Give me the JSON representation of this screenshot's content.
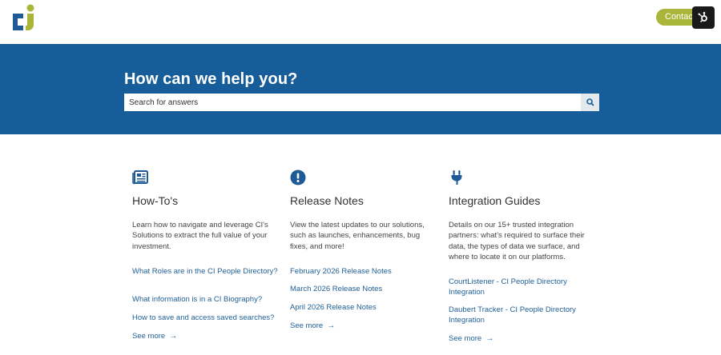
{
  "header": {
    "logo_icon": "ci-logo-icon",
    "contact_label": "Contact",
    "hub_icon": "hubspot-icon"
  },
  "hero": {
    "title": "How can we help you?",
    "search_placeholder": "Search for answers",
    "search_icon": "search-icon"
  },
  "columns": [
    {
      "icon": "newspaper-icon",
      "title": "How-To's",
      "description": "Learn how to navigate and leverage CI's Solutions to extract the full value of your investment.",
      "links": [
        "What Roles are in the CI People Directory?",
        "What information is in a CI Biography?",
        "How to save and access saved searches?"
      ],
      "see_more": "See more"
    },
    {
      "icon": "exclamation-circle-icon",
      "title": "Release Notes",
      "description": "View the latest updates to our solutions, such as launches, enhancements, bug fixes, and more!",
      "links": [
        "February 2026 Release Notes",
        "March 2026 Release Notes",
        "April 2026 Release Notes"
      ],
      "see_more": "See more"
    },
    {
      "icon": "plug-icon",
      "title": "Integration Guides",
      "description": "Details on our 15+ trusted integration partners: what's required to surface their data, the types of data we surface, and where to locate it on our platforms.",
      "links": [
        "CourtListener - CI People Directory Integration",
        "Daubert Tracker - CI People Directory Integration"
      ],
      "see_more": "See more"
    }
  ],
  "colors": {
    "hero_bg": "#165d99",
    "accent_green": "#a9b639",
    "link_blue": "#1f5f97"
  }
}
